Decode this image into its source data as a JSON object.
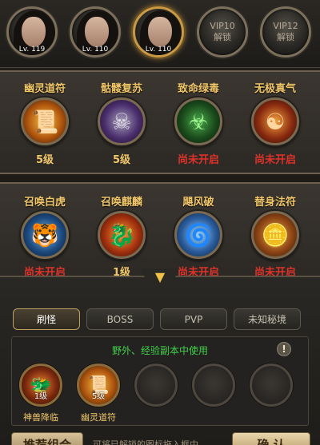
{
  "characters": [
    {
      "level": "Lv. 119"
    },
    {
      "level": "Lv. 110"
    },
    {
      "level": "Lv. 110"
    }
  ],
  "vip_slots": [
    {
      "label": "VIP10",
      "action": "解锁"
    },
    {
      "label": "VIP12",
      "action": "解锁"
    }
  ],
  "skills_row1": [
    {
      "name": "幽灵道符",
      "status": "5级",
      "icon": "talisman-icon"
    },
    {
      "name": "骷髅复苏",
      "status": "5级",
      "icon": "skull-icon"
    },
    {
      "name": "致命绿毒",
      "status": "尚未开启",
      "icon": "poison-icon"
    },
    {
      "name": "无极真气",
      "status": "尚未开启",
      "icon": "qi-icon"
    }
  ],
  "skills_row2": [
    {
      "name": "召唤白虎",
      "status": "尚未开启",
      "icon": "tiger-icon"
    },
    {
      "name": "召唤麒麟",
      "status": "1级",
      "icon": "qilin-icon"
    },
    {
      "name": "飓风破",
      "status": "尚未开启",
      "icon": "wind-icon"
    },
    {
      "name": "替身法符",
      "status": "尚未开启",
      "icon": "charm-icon"
    }
  ],
  "tabs": [
    "刷怪",
    "BOSS",
    "PVP",
    "未知秘境"
  ],
  "hint": "野外、经验副本中使用",
  "equipped": [
    {
      "name": "神兽降临",
      "level": "1级"
    },
    {
      "name": "幽灵道符",
      "level": "5级"
    }
  ],
  "footer": {
    "recommend": "推荐组合",
    "hint": "可将已解锁的图标拖入框中",
    "confirm": "确 认"
  }
}
